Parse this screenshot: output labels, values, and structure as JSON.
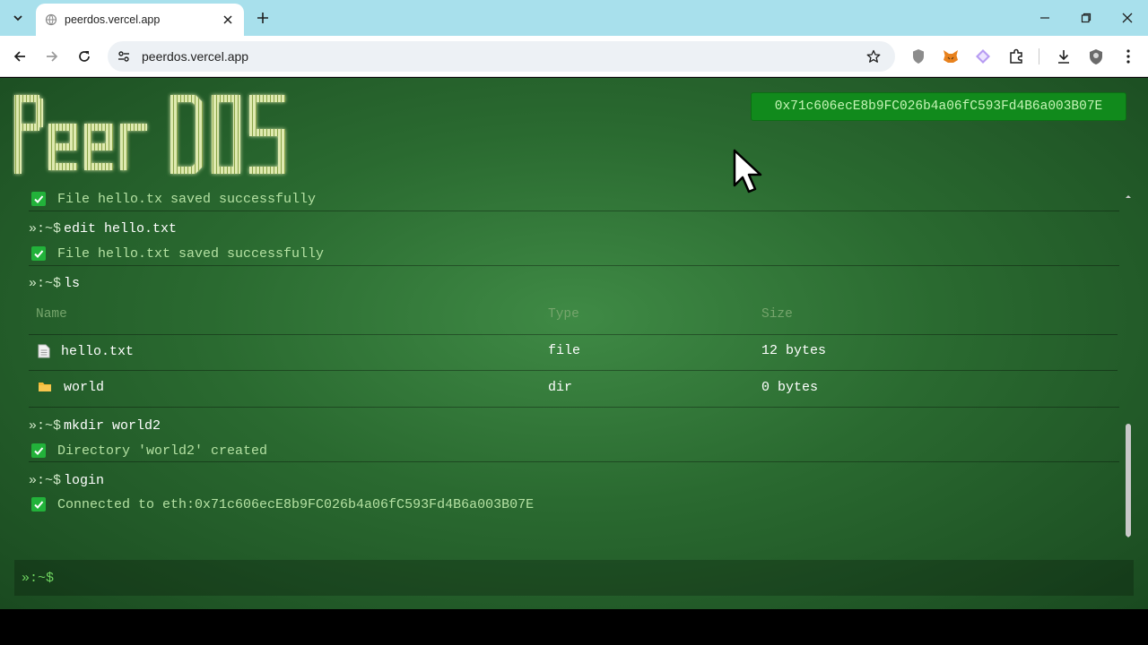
{
  "browser": {
    "tab_title": "peerdos.vercel.app",
    "url": "peerdos.vercel.app"
  },
  "app": {
    "logo_text": "PeerDOS",
    "wallet_address": "0x71c606ecE8b9FC026b4a06fC593Fd4B6a003B07E",
    "prompt": "»:~$",
    "input_value": "",
    "colors": {
      "accent": "#118a1c",
      "check": "#22b23a",
      "message": "#b4e1a2"
    }
  },
  "terminal": {
    "entries": [
      {
        "message": "File hello.tx saved successfully"
      },
      {
        "command": "edit hello.txt",
        "message": "File hello.txt saved successfully"
      },
      {
        "command": "ls"
      },
      {
        "command": "mkdir world2",
        "message": "Directory 'world2' created"
      },
      {
        "command": "login",
        "message": "Connected to eth:0x71c606ecE8b9FC026b4a06fC593Fd4B6a003B07E"
      }
    ],
    "table": {
      "headers": [
        "Name",
        "Type",
        "Size"
      ],
      "rows": [
        {
          "icon": "file-icon",
          "name": "hello.txt",
          "type": "file",
          "size": "12 bytes"
        },
        {
          "icon": "folder-icon",
          "name": "world",
          "type": "dir",
          "size": "0 bytes"
        }
      ]
    }
  }
}
